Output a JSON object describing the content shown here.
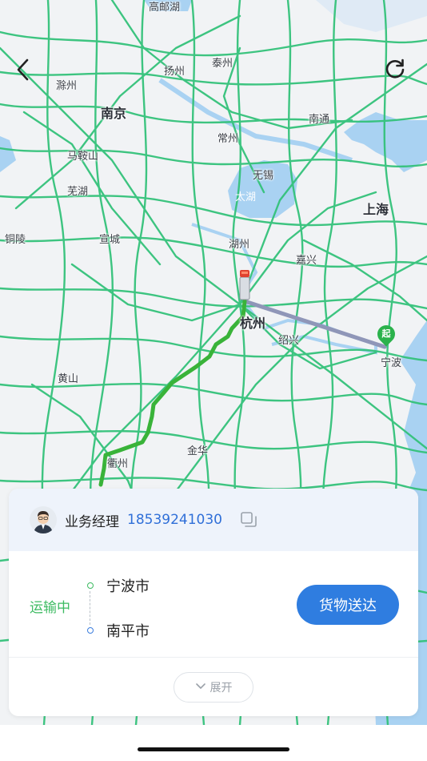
{
  "map": {
    "places": [
      {
        "id": "gaoyou",
        "name": "高邮湖",
        "kind": "lake"
      },
      {
        "id": "chuzhou",
        "name": "滁州",
        "kind": "city"
      },
      {
        "id": "yangzhou",
        "name": "扬州",
        "kind": "city"
      },
      {
        "id": "taizhou",
        "name": "泰州",
        "kind": "city"
      },
      {
        "id": "nanjing",
        "name": "南京",
        "kind": "big"
      },
      {
        "id": "nantong",
        "name": "南通",
        "kind": "city"
      },
      {
        "id": "changzhou",
        "name": "常州",
        "kind": "city"
      },
      {
        "id": "maanshan",
        "name": "马鞍山",
        "kind": "city"
      },
      {
        "id": "wuxi",
        "name": "无锡",
        "kind": "city"
      },
      {
        "id": "wuhu",
        "name": "芜湖",
        "kind": "city"
      },
      {
        "id": "taihu",
        "name": "太湖",
        "kind": "lake"
      },
      {
        "id": "shanghai",
        "name": "上海",
        "kind": "big"
      },
      {
        "id": "tongling",
        "name": "铜陵",
        "kind": "city"
      },
      {
        "id": "xuancheng",
        "name": "宣城",
        "kind": "city"
      },
      {
        "id": "huzhou",
        "name": "湖州",
        "kind": "city"
      },
      {
        "id": "jiaxing",
        "name": "嘉兴",
        "kind": "city"
      },
      {
        "id": "hangzhou",
        "name": "杭州",
        "kind": "big"
      },
      {
        "id": "shaoxing",
        "name": "绍兴",
        "kind": "city"
      },
      {
        "id": "ningbo",
        "name": "宁波",
        "kind": "city"
      },
      {
        "id": "huangshan",
        "name": "黄山",
        "kind": "city"
      },
      {
        "id": "jinhua",
        "name": "金华",
        "kind": "city"
      },
      {
        "id": "quzhou",
        "name": "衢州",
        "kind": "city"
      }
    ],
    "start_marker": "起",
    "route_color": "#3bb53b",
    "road_color": "#33c27a",
    "water_color": "#a9d2f2"
  },
  "nav": {
    "back_icon": "chevron-left-icon",
    "refresh_icon": "refresh-icon"
  },
  "card": {
    "manager_label": "业务经理",
    "manager_phone": "18539241030",
    "status": "运输中",
    "origin": "宁波市",
    "destination": "南平市",
    "action_label": "货物送达",
    "expand_label": "展开",
    "accent": "#2f7de0",
    "status_color": "#3dbb62"
  }
}
